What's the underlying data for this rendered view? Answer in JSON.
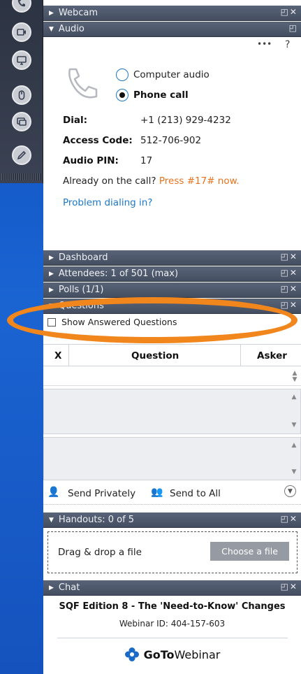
{
  "panels": {
    "webcam": "Webcam",
    "audio": "Audio",
    "dashboard": "Dashboard",
    "attendees": "Attendees: 1 of 501 (max)",
    "polls": "Polls (1/1)",
    "questions": "Questions",
    "handouts": "Handouts: 0 of 5",
    "chat": "Chat"
  },
  "audio": {
    "more": "•••",
    "help": "?",
    "options": [
      "Computer audio",
      "Phone call"
    ],
    "dial_label": "Dial:",
    "dial_value": "+1 (213) 929-4232",
    "code_label": "Access Code:",
    "code_value": "512-706-902",
    "pin_label": "Audio PIN:",
    "pin_value": "17",
    "already_text": "Already on the call?",
    "press_text": "Press #17# now.",
    "problem_link": "Problem dialing in?"
  },
  "questions": {
    "show_answered": "Show Answered Questions",
    "col_x": "X",
    "col_question": "Question",
    "col_asker": "Asker",
    "send_privately": "Send Privately",
    "send_all": "Send to All"
  },
  "handouts": {
    "drag_text": "Drag & drop a file",
    "choose_button": "Choose a file"
  },
  "footer": {
    "title": "SQF Edition 8 - The 'Need-to-Know' Changes",
    "webinar_id": "Webinar ID: 404-157-603",
    "brand_goto": "GoTo",
    "brand_webinar": "Webinar"
  },
  "colors": {
    "accent_orange": "#f0861c",
    "link_blue": "#1c78c8",
    "press_orange": "#e8721e"
  }
}
